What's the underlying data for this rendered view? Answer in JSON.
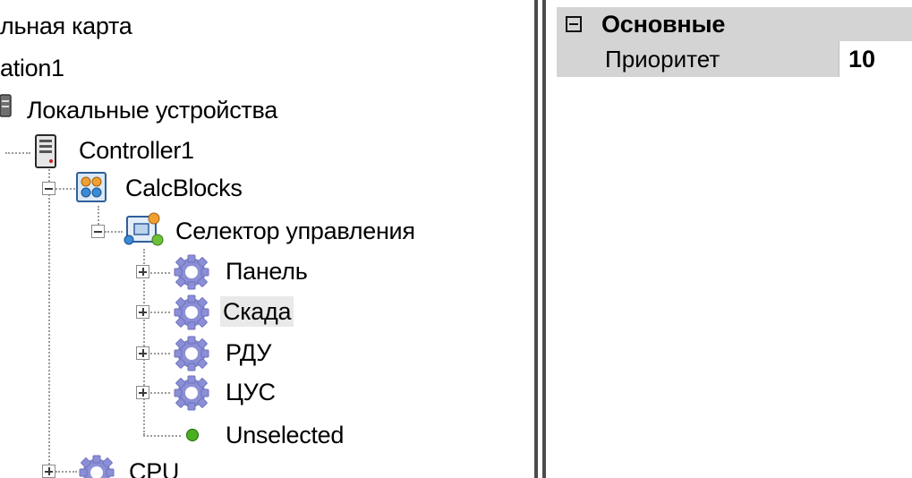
{
  "tree": {
    "node_map": "льная карта",
    "node_station": "ation1",
    "node_local_devices": "Локальные устройства",
    "node_controller": "Controller1",
    "node_calcblocks": "CalcBlocks",
    "node_selector": "Селектор управления",
    "items": [
      {
        "label": "Панель"
      },
      {
        "label": "Скада"
      },
      {
        "label": "РДУ"
      },
      {
        "label": "ЦУС"
      }
    ],
    "node_unselected": "Unselected",
    "node_cpu": "CPU",
    "selected_item": "Скада"
  },
  "properties": {
    "category": "Основные",
    "rows": [
      {
        "name": "Приоритет",
        "value": "10"
      }
    ]
  },
  "icons": {
    "local_devices": "device-icon",
    "controller": "server-icon",
    "calcblocks": "calc-blocks-icon",
    "selector": "selector-block-icon",
    "items": "gear-icon",
    "unselected": "green-dot-icon",
    "cpu": "gear-icon"
  },
  "colors": {
    "gear": "#8b8fd6",
    "gear_dark": "#6e72bf",
    "category_bg": "#d4d4d4",
    "selection_bg": "#e9e9e9",
    "splitter": "#4b4b4b",
    "dot_green": "#4caf22"
  }
}
